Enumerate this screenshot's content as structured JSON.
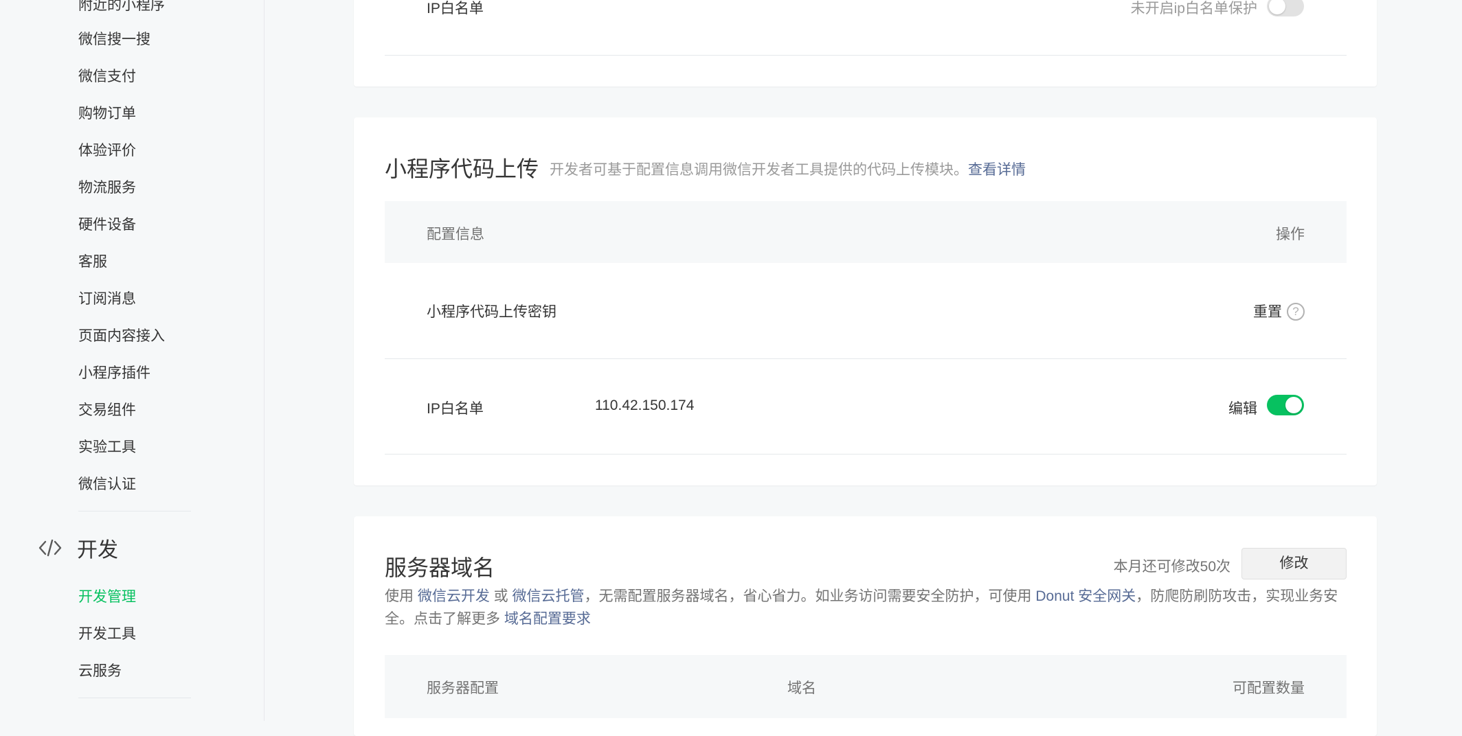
{
  "sidebar": {
    "items": [
      "附近的小程序",
      "微信搜一搜",
      "微信支付",
      "购物订单",
      "体验评价",
      "物流服务",
      "硬件设备",
      "客服",
      "订阅消息",
      "页面内容接入",
      "小程序插件",
      "交易组件",
      "实验工具",
      "微信认证"
    ],
    "dev_section": {
      "icon": "code-icon",
      "label": "开发",
      "items": [
        "开发管理",
        "开发工具",
        "云服务"
      ],
      "active": "开发管理"
    }
  },
  "card_ip": {
    "label": "IP白名单",
    "status_text": "未开启ip白名单保护",
    "toggle_on": false
  },
  "card_upload": {
    "title": "小程序代码上传",
    "desc": "开发者可基于配置信息调用微信开发者工具提供的代码上传模块。",
    "detail_link": "查看详情",
    "headers": {
      "config": "配置信息",
      "action": "操作"
    },
    "rows": [
      {
        "label": "小程序代码上传密钥",
        "action": "重置",
        "help_icon": "question-circle-icon",
        "help_glyph": "?"
      },
      {
        "label": "IP白名单",
        "value": "110.42.150.174",
        "action": "编辑",
        "toggle_on": true
      }
    ]
  },
  "card_domain": {
    "title": "服务器域名",
    "remaining": "本月还可修改50次",
    "modify_button": "修改",
    "notice": {
      "t1": "使用 ",
      "link1": "微信云开发",
      "t2": " 或 ",
      "link2": "微信云托管",
      "t3": "，无需配置服务器域名，省心省力。如业务访问需要安全防护，可使用 ",
      "link3": "Donut 安全网关",
      "t4": "，防爬防刷防攻击，实现业务安全。点击了解更多 ",
      "link4": "域名配置要求"
    },
    "headers": {
      "config": "服务器配置",
      "domain": "域名",
      "count": "可配置数量"
    }
  },
  "colors": {
    "accent": "#07c160",
    "link": "#576b95",
    "background": "#f6f8f9"
  }
}
